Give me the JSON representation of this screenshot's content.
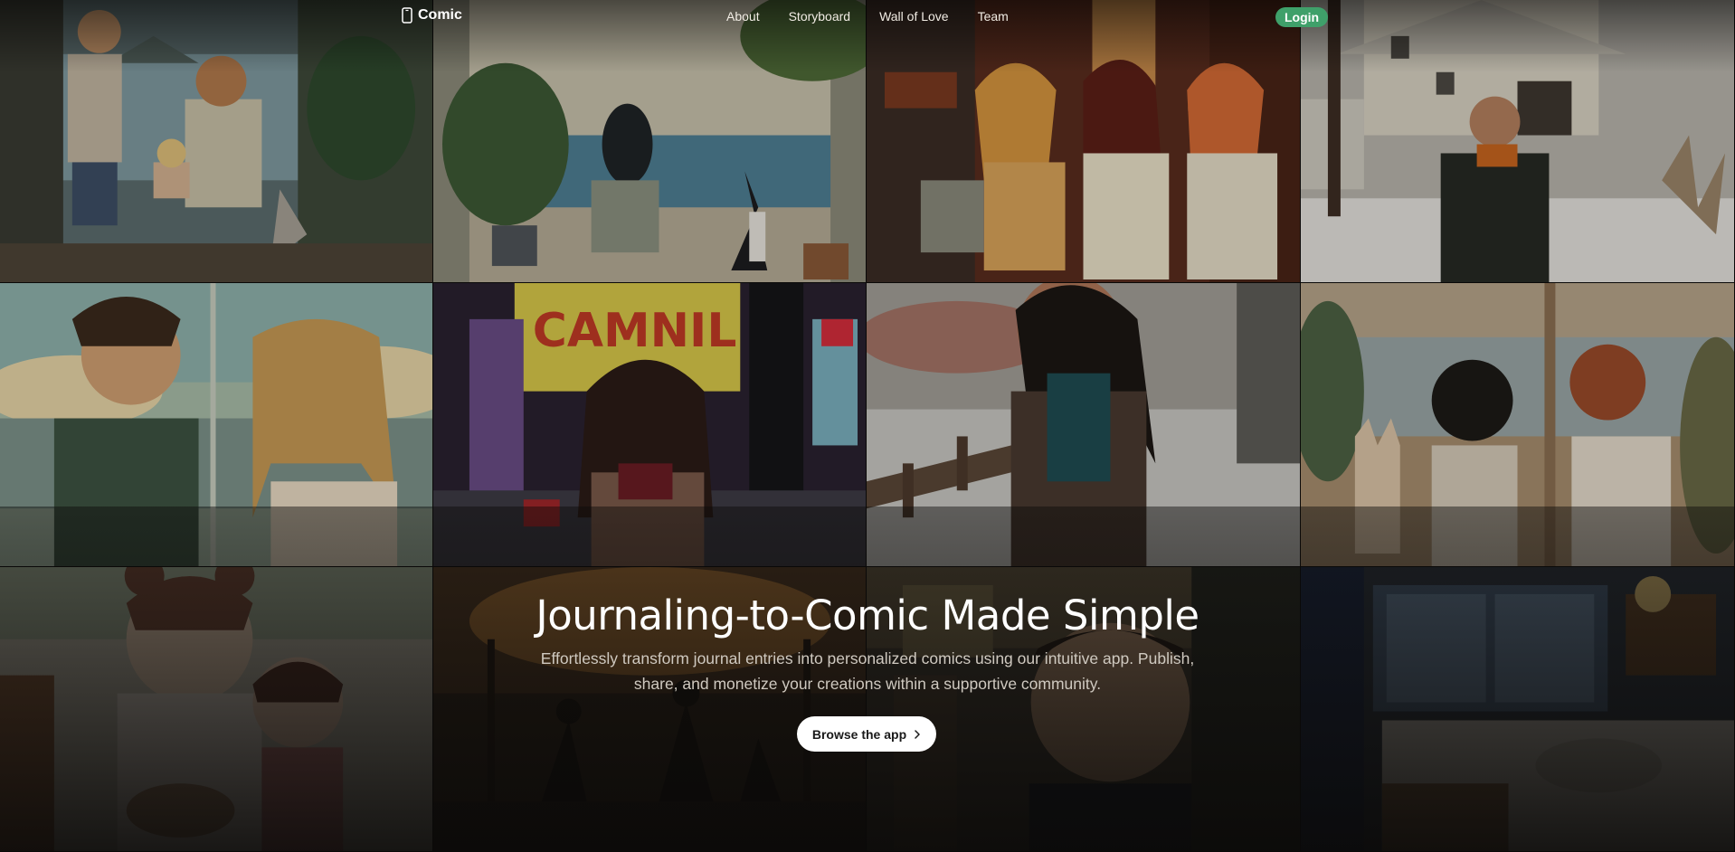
{
  "brand": {
    "name": "Comic",
    "icon": "phone-icon"
  },
  "nav": {
    "links": [
      "About",
      "Storyboard",
      "Wall of Love",
      "Team"
    ],
    "login_label": "Login"
  },
  "hero": {
    "title": "Journaling-to-Comic Made Simple",
    "subtitle": "Effortlessly transform journal entries into personalized comics using our intuitive app. Publish, share, and monetize your creations within a supportive community.",
    "cta_label": "Browse the app",
    "cta_icon": "chevron-right-icon"
  },
  "colors": {
    "login_bg": "#3fa06a",
    "cta_bg": "#ffffff",
    "page_bg": "#141310"
  }
}
